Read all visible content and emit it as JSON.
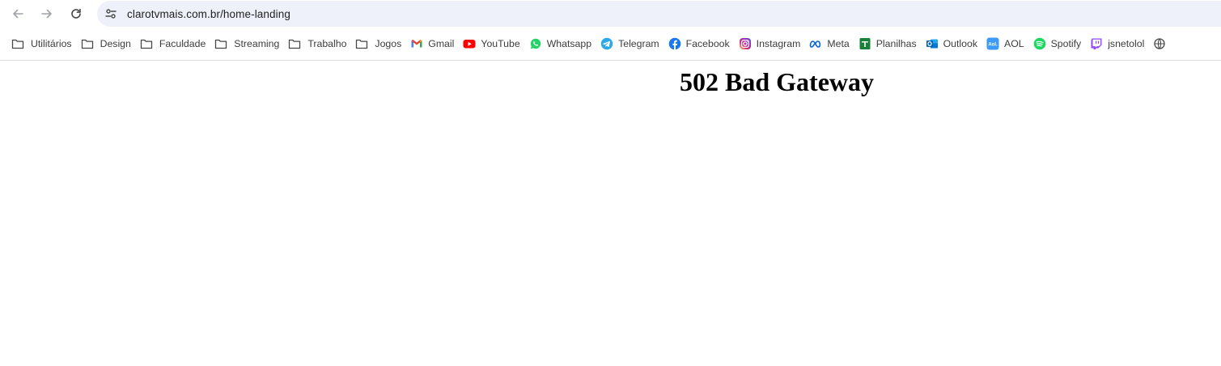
{
  "browser": {
    "url": "clarotvmais.com.br/home-landing"
  },
  "bookmarks": [
    {
      "label": "Utilitários",
      "icon": "folder-icon"
    },
    {
      "label": "Design",
      "icon": "folder-icon"
    },
    {
      "label": "Faculdade",
      "icon": "folder-icon"
    },
    {
      "label": "Streaming",
      "icon": "folder-icon"
    },
    {
      "label": "Trabalho",
      "icon": "folder-icon"
    },
    {
      "label": "Jogos",
      "icon": "folder-icon"
    },
    {
      "label": "Gmail",
      "icon": "gmail-icon",
      "color": "#ea4335"
    },
    {
      "label": "YouTube",
      "icon": "youtube-icon",
      "color": "#ff0000"
    },
    {
      "label": "Whatsapp",
      "icon": "whatsapp-icon",
      "color": "#25d366"
    },
    {
      "label": "Telegram",
      "icon": "telegram-icon",
      "color": "#29a9eb"
    },
    {
      "label": "Facebook",
      "icon": "facebook-icon",
      "color": "#1877f2"
    },
    {
      "label": "Instagram",
      "icon": "instagram-icon",
      "color": "#e1306c"
    },
    {
      "label": "Meta",
      "icon": "meta-icon",
      "color": "#0668e1"
    },
    {
      "label": "Planilhas",
      "icon": "sheets-icon",
      "color": "#188038"
    },
    {
      "label": "Outlook",
      "icon": "outlook-icon",
      "color": "#0078d4"
    },
    {
      "label": "AOL",
      "icon": "aol-icon",
      "color": "#3d9bf5"
    },
    {
      "label": "Spotify",
      "icon": "spotify-icon",
      "color": "#1ed760"
    },
    {
      "label": "jsnetolol",
      "icon": "twitch-icon",
      "color": "#9146ff"
    }
  ],
  "page": {
    "title": "502 Bad Gateway"
  }
}
